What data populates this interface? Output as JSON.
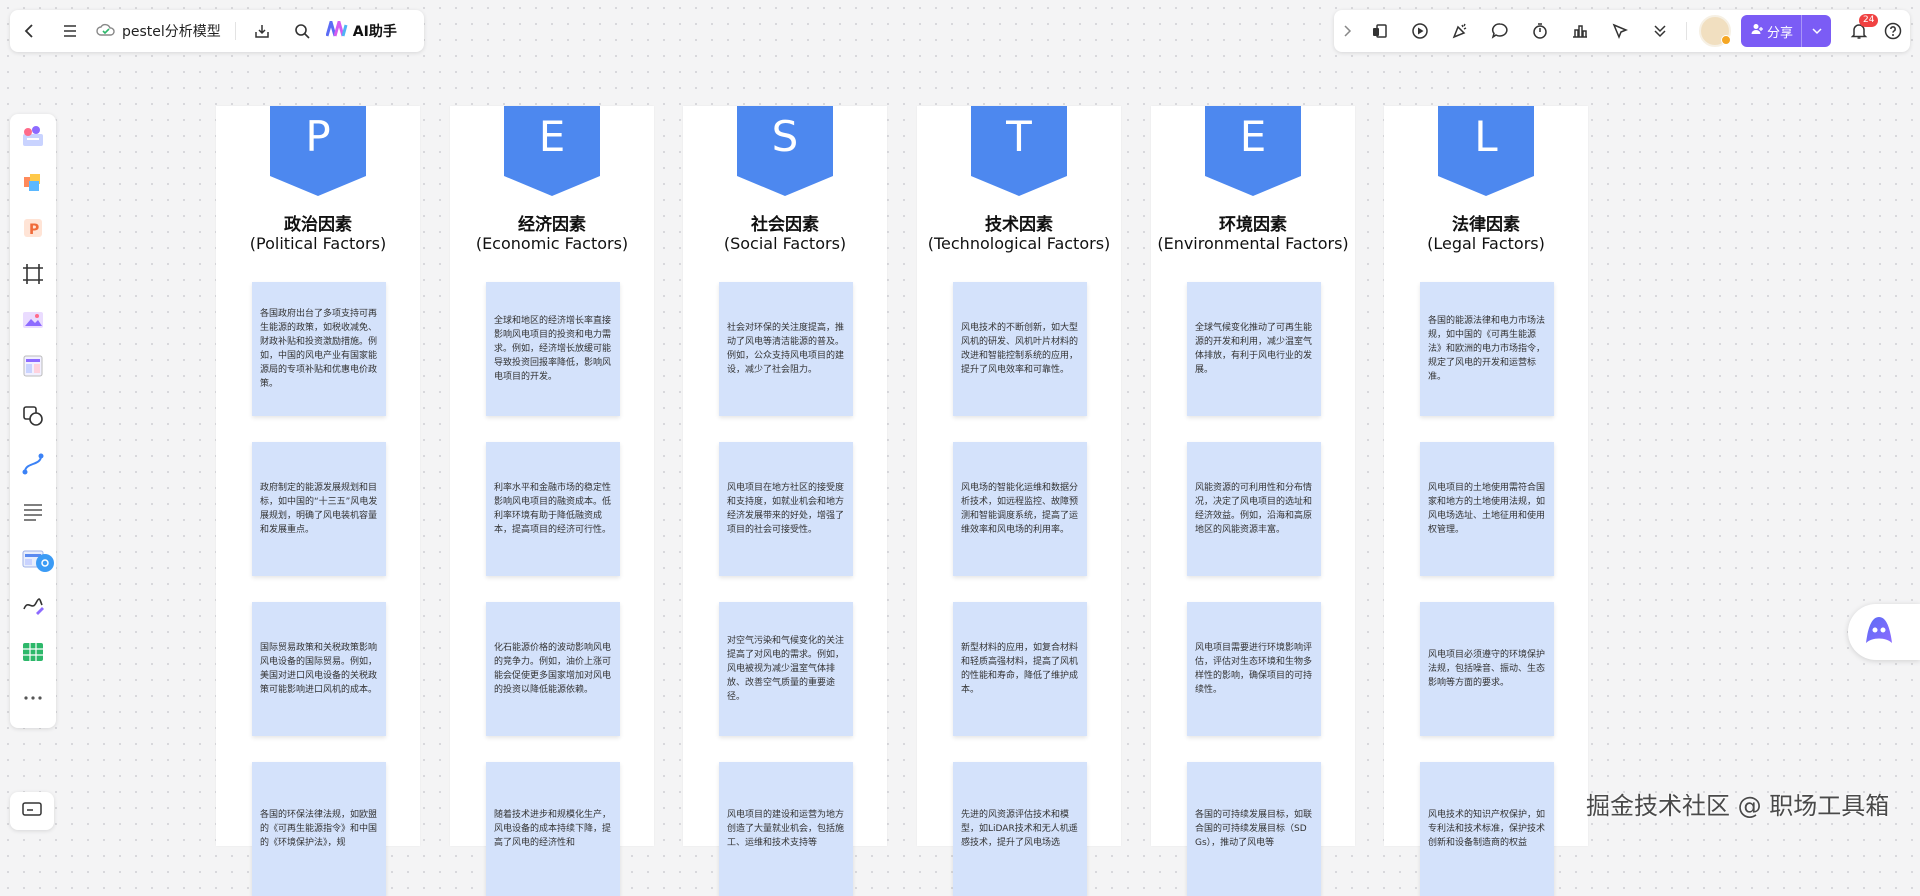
{
  "header": {
    "doc_title": "pestel分析模型",
    "ai_label": "AI助手",
    "share_label": "分享",
    "notification_count": "24"
  },
  "colors": {
    "accent": "#4d88ef",
    "note": "#d4e2fb",
    "share": "#7b5cf5"
  },
  "left_tools": [
    "templates-icon",
    "stickers-icon",
    "text-p-icon",
    "frame-icon",
    "image-icon",
    "layout-icon",
    "shapes-icon",
    "connector-icon",
    "list-icon",
    "table-card-icon",
    "pen-icon",
    "spreadsheet-icon",
    "more-icon"
  ],
  "columns": [
    {
      "letter": "P",
      "title_cn": "政治因素",
      "title_en": "(Political Factors)",
      "notes": [
        "各国政府出台了多项支持可再生能源的政策，如税收减免、财政补贴和投资激励措施。例如，中国的风电产业有国家能源局的专项补贴和优惠电价政策。",
        "政府制定的能源发展规划和目标，如中国的“十三五”风电发展规划，明确了风电装机容量和发展重点。",
        "国际贸易政策和关税政策影响风电设备的国际贸易。例如，美国对进口风电设备的关税政策可能影响进口风机的成本。",
        "各国的环保法律法规，如欧盟的《可再生能源指令》和中国的《环境保护法》，规"
      ]
    },
    {
      "letter": "E",
      "title_cn": "经济因素",
      "title_en": "(Economic Factors)",
      "notes": [
        "全球和地区的经济增长率直接影响风电项目的投资和电力需求。例如，经济增长放缓可能导致投资回报率降低，影响风电项目的开发。",
        "利率水平和金融市场的稳定性影响风电项目的融资成本。低利率环境有助于降低融资成本，提高项目的经济可行性。",
        "化石能源价格的波动影响风电的竞争力。例如，油价上涨可能会促使更多国家增加对风电的投资以降低能源依赖。",
        "随着技术进步和规模化生产，风电设备的成本持续下降，提高了风电的经济性和"
      ]
    },
    {
      "letter": "S",
      "title_cn": "社会因素",
      "title_en": "(Social Factors)",
      "notes": [
        "社会对环保的关注度提高，推动了风电等清洁能源的普及。例如，公众支持风电项目的建设，减少了社会阻力。",
        "风电项目在地方社区的接受度和支持度，如就业机会和地方经济发展带来的好处，增强了项目的社会可接受性。",
        "对空气污染和气候变化的关注提高了对风电的需求。例如，风电被视为减少温室气体排放、改善空气质量的重要途径。",
        "风电项目的建设和运营为地方创造了大量就业机会，包括施工、运维和技术支持等"
      ]
    },
    {
      "letter": "T",
      "title_cn": "技术因素",
      "title_en": "(Technological Factors)",
      "notes": [
        "风电技术的不断创新，如大型风机的研发、风机叶片材料的改进和智能控制系统的应用，提升了风电效率和可靠性。",
        "风电场的智能化运维和数据分析技术，如远程监控、故障预测和智能调度系统，提高了运维效率和风电场的利用率。",
        "新型材料的应用，如复合材料和轻质高强材料，提高了风机的性能和寿命，降低了维护成本。",
        "先进的风资源评估技术和模型，如LiDAR技术和无人机遥感技术，提升了风电场选"
      ]
    },
    {
      "letter": "E",
      "title_cn": "环境因素",
      "title_en": "(Environmental Factors)",
      "notes": [
        "全球气候变化推动了可再生能源的开发和利用，减少温室气体排放，有利于风电行业的发展。",
        "风能资源的可利用性和分布情况，决定了风电项目的选址和经济效益。例如，沿海和高原地区的风能资源丰富。",
        "风电项目需要进行环境影响评估，评估对生态环境和生物多样性的影响，确保项目的可持续性。",
        "各国的可持续发展目标，如联合国的可持续发展目标（SDGs），推动了风电等"
      ]
    },
    {
      "letter": "L",
      "title_cn": "法律因素",
      "title_en": "(Legal Factors)",
      "notes": [
        "各国的能源法律和电力市场法规，如中国的《可再生能源法》和欧洲的电力市场指令，规定了风电的开发和运营标准。",
        "风电项目的土地使用需符合国家和地方的土地使用法规，如风电场选址、土地征用和使用权管理。",
        "风电项目必须遵守的环境保护法规，包括噪音、振动、生态影响等方面的要求。",
        "风电技术的知识产权保护，如专利法和技术标准，保护技术创新和设备制造商的权益"
      ]
    }
  ],
  "watermark": "掘金技术社区 @ 职场工具箱"
}
